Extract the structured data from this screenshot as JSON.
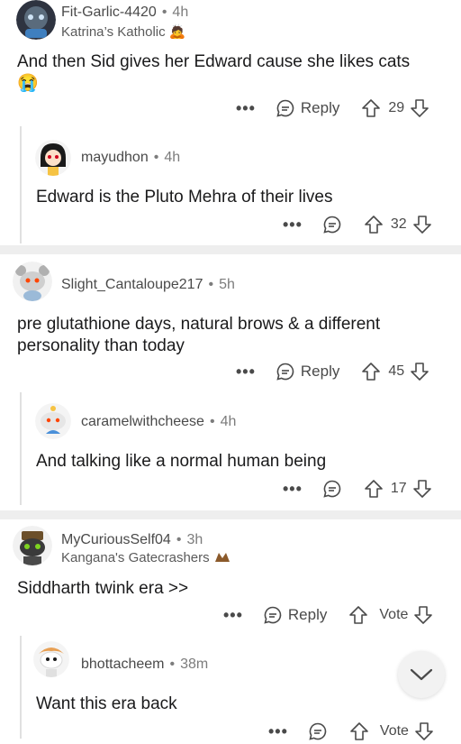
{
  "comments": [
    {
      "username": "Fit-Garlic-4420",
      "time": "4h",
      "flair": "Katrina’s Katholic",
      "flair_emoji": "🙇",
      "body_line1": "And then Sid gives her Edward cause she likes cats",
      "body_emoji": "😭",
      "reply_label": "Reply",
      "votes": "29"
    },
    {
      "username": "mayudhon",
      "time": "4h",
      "body": "Edward is the Pluto Mehra of their lives",
      "votes": "32"
    },
    {
      "username": "Slight_Cantaloupe217",
      "time": "5h",
      "body_line1": "pre glutathione days, natural brows & a different",
      "body_line2": "personality than today",
      "reply_label": "Reply",
      "votes": "45"
    },
    {
      "username": "caramelwithcheese",
      "time": "4h",
      "body": "And talking like a normal human being",
      "votes": "17"
    },
    {
      "username": "MyCuriousSelf04",
      "time": "3h",
      "flair": "Kangana's Gatecrashers",
      "body": "Siddharth twink era >>",
      "reply_label": "Reply",
      "votes": "Vote"
    },
    {
      "username": "bhottacheem",
      "time": "38m",
      "body": "Want this era back",
      "votes": "Vote"
    }
  ],
  "more_label": "•••",
  "dot": "•",
  "icons": {
    "reply": "reply-bubble-icon",
    "upvote": "upvote-arrow-icon",
    "downvote": "downvote-arrow-icon",
    "collapse": "chevron-down-icon"
  }
}
